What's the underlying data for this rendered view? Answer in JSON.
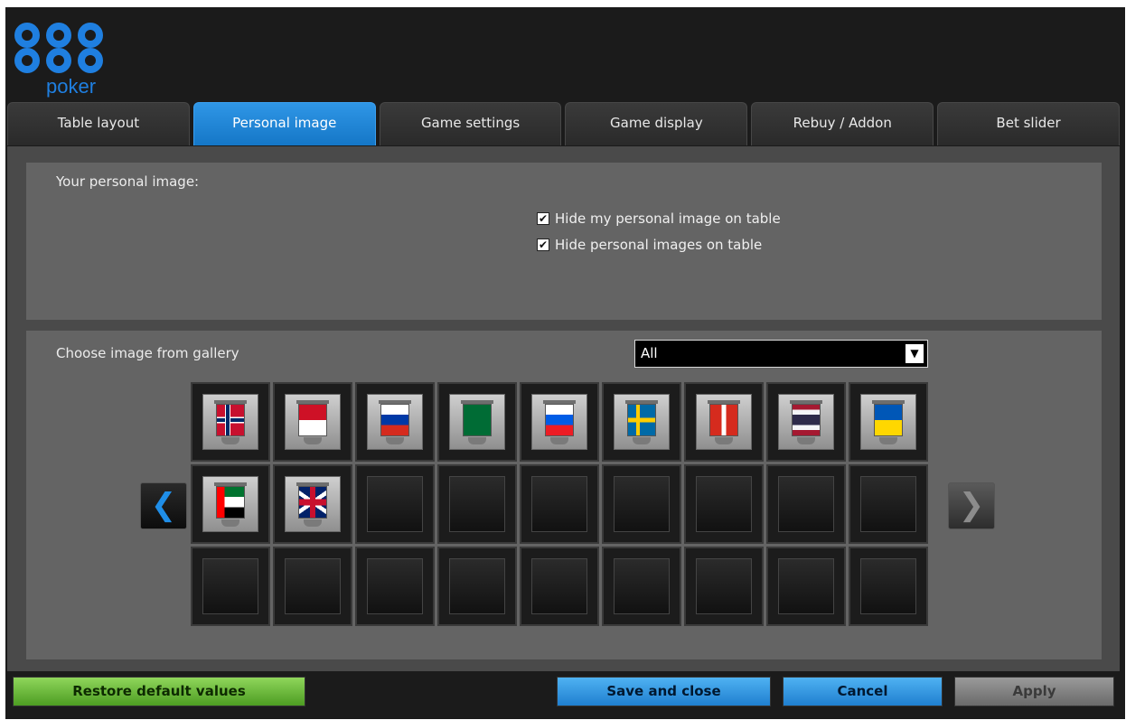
{
  "brand": {
    "name": "888",
    "word": "poker",
    "color": "#1f7fe0"
  },
  "tabs": [
    {
      "label": "Table layout",
      "active": false
    },
    {
      "label": "Personal image",
      "active": true
    },
    {
      "label": "Game settings",
      "active": false
    },
    {
      "label": "Game display",
      "active": false
    },
    {
      "label": "Rebuy / Addon",
      "active": false
    },
    {
      "label": "Bet slider",
      "active": false
    }
  ],
  "personal_image": {
    "heading": "Your personal image:",
    "options": [
      {
        "label": "Hide my personal image on table",
        "checked": true
      },
      {
        "label": "Hide personal images on table",
        "checked": true
      }
    ]
  },
  "gallery": {
    "heading": "Choose image from gallery",
    "filter_value": "All",
    "prev_icon": "chevron-left-icon",
    "next_icon": "chevron-right-icon",
    "images": [
      "norway-flag-icon",
      "monaco-flag-icon",
      "russia-flag-icon",
      "saudi-arabia-flag-icon",
      "slovenia-flag-icon",
      "sweden-flag-icon",
      "switzerland-flag-icon",
      "thailand-flag-icon",
      "ukraine-flag-icon",
      "uae-flag-icon",
      "united-kingdom-flag-icon"
    ],
    "total_slots": 27
  },
  "footer": {
    "restore_label": "Restore default values",
    "save_label": "Save and close",
    "cancel_label": "Cancel",
    "apply_label": "Apply"
  }
}
